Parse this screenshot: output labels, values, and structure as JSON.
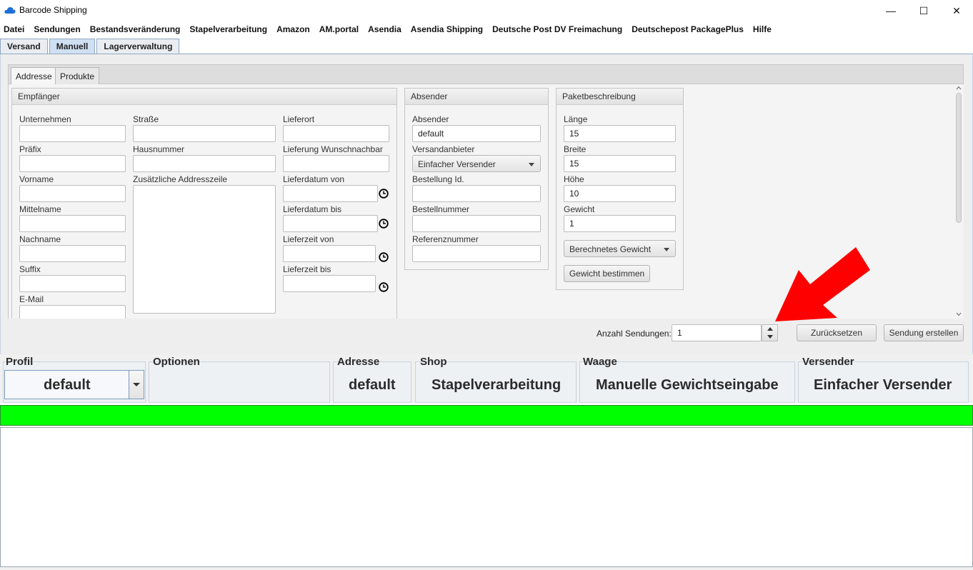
{
  "window": {
    "title": "Barcode Shipping",
    "controls": [
      "—",
      "☐",
      "✕"
    ]
  },
  "menu": [
    "Datei",
    "Sendungen",
    "Bestandsveränderung",
    "Stapelverarbeitung",
    "Amazon",
    "AM.portal",
    "Asendia",
    "Asendia Shipping",
    "Deutsche Post DV Freimachung",
    "Deutschepost PackagePlus",
    "Hilfe"
  ],
  "top_tabs": [
    "Versand",
    "Manuell",
    "Lagerverwaltung"
  ],
  "inner_tabs": [
    "Addresse",
    "Produkte"
  ],
  "empfaenger": {
    "title": "Empfänger",
    "col1": [
      "Unternehmen",
      "Präfix",
      "Vorname",
      "Mittelname",
      "Nachname",
      "Suffix",
      "E-Mail"
    ],
    "col2": [
      "Straße",
      "Hausnummer",
      "Zusätzliche Addresszeile"
    ],
    "col3": [
      "Lieferort",
      "Lieferung Wunschnachbar",
      "Lieferdatum von",
      "Lieferdatum bis",
      "Lieferzeit von",
      "Lieferzeit bis"
    ]
  },
  "absender": {
    "title": "Absender",
    "absender_label": "Absender",
    "absender_value": "default",
    "versandanbieter_label": "Versandanbieter",
    "versandanbieter_value": "Einfacher Versender",
    "bestellung_id_label": "Bestellung Id.",
    "bestellnummer_label": "Bestellnummer",
    "referenznummer_label": "Referenznummer"
  },
  "paket": {
    "title": "Paketbeschreibung",
    "laenge_label": "Länge",
    "laenge_value": "15",
    "breite_label": "Breite",
    "breite_value": "15",
    "hoehe_label": "Höhe",
    "hoehe_value": "10",
    "gewicht_label": "Gewicht",
    "gewicht_value": "1",
    "gewicht_modus": "Berechnetes Gewicht",
    "bestimmen_label": "Gewicht bestimmen"
  },
  "actions": {
    "anzahl_label": "Anzahl Sendungen:",
    "anzahl_value": "1",
    "reset_label": "Zurücksetzen",
    "create_label": "Sendung erstellen"
  },
  "status": {
    "profil_title": "Profil",
    "profil_value": "default",
    "optionen_title": "Optionen",
    "adresse_title": "Adresse",
    "adresse_value": "default",
    "shop_title": "Shop",
    "shop_value": "Stapelverarbeitung",
    "waage_title": "Waage",
    "waage_value": "Manuelle Gewichtseingabe",
    "versender_title": "Versender",
    "versender_value": "Einfacher Versender"
  },
  "colors": {
    "status_bar": "#00ff00",
    "annotation_arrow": "#ff0000"
  }
}
